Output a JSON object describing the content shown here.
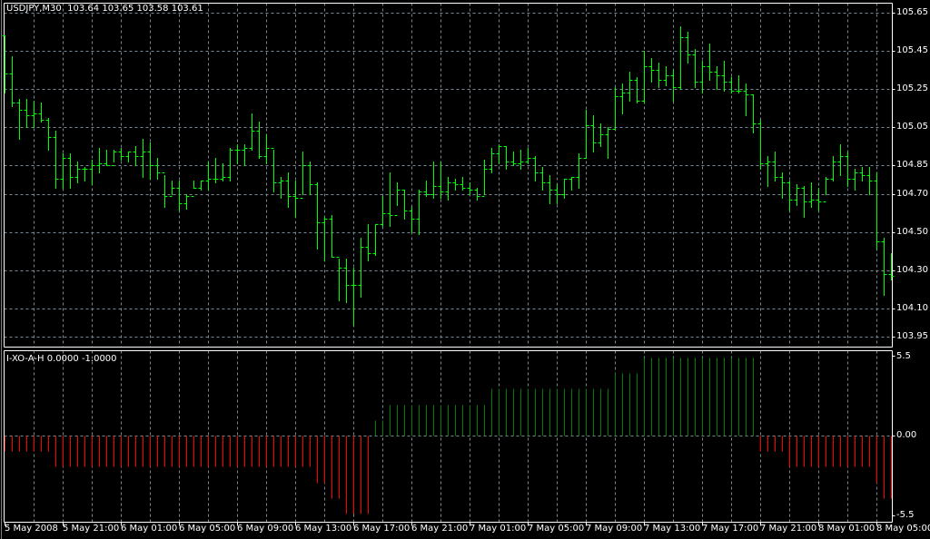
{
  "header": {
    "symbol": "USDJPY,M30",
    "open": "103.64",
    "high": "103.65",
    "low": "103.58",
    "close": "103.61"
  },
  "indicator": {
    "name": "I-XO-A-H",
    "value1": "0.0000",
    "value2": "-1.0000",
    "axis_labels": [
      "5.5",
      "0.00",
      "-5.5"
    ]
  },
  "price_axis": [
    "105.65",
    "105.45",
    "105.25",
    "105.05",
    "104.85",
    "104.70",
    "104.50",
    "104.30",
    "104.10",
    "103.95"
  ],
  "time_axis": [
    "5 May 2008",
    "5 May 21:00",
    "6 May 01:00",
    "6 May 05:00",
    "6 May 09:00",
    "6 May 13:00",
    "6 May 17:00",
    "6 May 21:00",
    "7 May 01:00",
    "7 May 05:00",
    "7 May 09:00",
    "7 May 13:00",
    "7 May 17:00",
    "7 May 21:00",
    "8 May 01:00",
    "8 May 05:00"
  ],
  "colors": {
    "background": "#000000",
    "grid": "#778899",
    "bars": "#00ff00",
    "hist_up": "#008000",
    "hist_down": "#ff0000",
    "text": "#ffffff"
  },
  "chart_data": {
    "type": "ohlc",
    "title": "USDJPY,M30",
    "ylim": [
      103.95,
      105.65
    ],
    "bar_format": [
      "high",
      "low",
      "close"
    ],
    "bars": [
      [
        105.53,
        105.23,
        105.33
      ],
      [
        105.42,
        105.16,
        105.18
      ],
      [
        105.2,
        104.99,
        105.14
      ],
      [
        105.2,
        105.05,
        105.11
      ],
      [
        105.19,
        105.05,
        105.12
      ],
      [
        105.18,
        105.08,
        105.09
      ],
      [
        105.1,
        104.93,
        105.0
      ],
      [
        105.03,
        104.73,
        104.78
      ],
      [
        104.91,
        104.73,
        104.89
      ],
      [
        104.91,
        104.73,
        104.79
      ],
      [
        104.87,
        104.76,
        104.83
      ],
      [
        104.84,
        104.77,
        104.83
      ],
      [
        104.88,
        104.75,
        104.85
      ],
      [
        104.94,
        104.81,
        104.86
      ],
      [
        104.93,
        104.85,
        104.85
      ],
      [
        104.93,
        104.87,
        104.92
      ],
      [
        104.94,
        104.88,
        104.9
      ],
      [
        104.92,
        104.87,
        104.92
      ],
      [
        104.95,
        104.85,
        104.9
      ],
      [
        104.99,
        104.79,
        104.92
      ],
      [
        104.97,
        104.78,
        104.85
      ],
      [
        104.89,
        104.78,
        104.81
      ],
      [
        104.8,
        104.63,
        104.69
      ],
      [
        104.77,
        104.7,
        104.73
      ],
      [
        104.77,
        104.61,
        104.65
      ],
      [
        104.7,
        104.62,
        104.69
      ],
      [
        104.77,
        104.73,
        104.73
      ],
      [
        104.77,
        104.72,
        104.77
      ],
      [
        104.87,
        104.72,
        104.78
      ],
      [
        104.89,
        104.76,
        104.78
      ],
      [
        104.86,
        104.77,
        104.79
      ],
      [
        104.94,
        104.77,
        104.93
      ],
      [
        104.96,
        104.86,
        104.93
      ],
      [
        104.96,
        104.85,
        104.94
      ],
      [
        105.12,
        104.93,
        105.03
      ],
      [
        105.08,
        104.89,
        104.9
      ],
      [
        105.01,
        104.86,
        104.94
      ],
      [
        104.93,
        104.71,
        104.76
      ],
      [
        104.79,
        104.68,
        104.77
      ],
      [
        104.81,
        104.63,
        104.69
      ],
      [
        104.77,
        104.58,
        104.68
      ],
      [
        104.92,
        104.7,
        104.85
      ],
      [
        104.87,
        104.7,
        104.75
      ],
      [
        104.76,
        104.41,
        104.55
      ],
      [
        104.58,
        104.35,
        104.57
      ],
      [
        104.59,
        104.37,
        104.37
      ],
      [
        104.36,
        104.14,
        104.31
      ],
      [
        104.36,
        104.13,
        104.22
      ],
      [
        104.31,
        104.01,
        104.22
      ],
      [
        104.47,
        104.16,
        104.42
      ],
      [
        104.54,
        104.35,
        104.39
      ],
      [
        104.54,
        104.38,
        104.54
      ],
      [
        104.69,
        104.53,
        104.6
      ],
      [
        104.81,
        104.53,
        104.59
      ],
      [
        104.76,
        104.64,
        104.72
      ],
      [
        104.72,
        104.57,
        104.61
      ],
      [
        104.63,
        104.5,
        104.57
      ],
      [
        104.72,
        104.49,
        104.71
      ],
      [
        104.77,
        104.69,
        104.7
      ],
      [
        104.87,
        104.68,
        104.74
      ],
      [
        104.87,
        104.68,
        104.71
      ],
      [
        104.79,
        104.67,
        104.76
      ],
      [
        104.78,
        104.72,
        104.75
      ],
      [
        104.79,
        104.72,
        104.73
      ],
      [
        104.76,
        104.7,
        104.72
      ],
      [
        104.73,
        104.67,
        104.69
      ],
      [
        104.88,
        104.7,
        104.83
      ],
      [
        104.94,
        104.81,
        104.91
      ],
      [
        104.96,
        104.86,
        104.95
      ],
      [
        104.95,
        104.83,
        104.87
      ],
      [
        104.92,
        104.85,
        104.86
      ],
      [
        104.93,
        104.83,
        104.87
      ],
      [
        104.94,
        104.86,
        104.89
      ],
      [
        104.9,
        104.77,
        104.81
      ],
      [
        104.84,
        104.72,
        104.76
      ],
      [
        104.8,
        104.65,
        104.72
      ],
      [
        104.75,
        104.65,
        104.7
      ],
      [
        104.78,
        104.68,
        104.78
      ],
      [
        104.79,
        104.72,
        104.79
      ],
      [
        104.91,
        104.73,
        104.89
      ],
      [
        105.14,
        104.89,
        105.06
      ],
      [
        105.11,
        104.92,
        104.97
      ],
      [
        105.07,
        104.95,
        105.01
      ],
      [
        105.05,
        104.89,
        105.04
      ],
      [
        105.26,
        105.04,
        105.21
      ],
      [
        105.28,
        105.12,
        105.23
      ],
      [
        105.34,
        105.19,
        105.3
      ],
      [
        105.31,
        105.18,
        105.19
      ],
      [
        105.45,
        105.18,
        105.37
      ],
      [
        105.41,
        105.29,
        105.35
      ],
      [
        105.39,
        105.26,
        105.3
      ],
      [
        105.37,
        105.27,
        105.32
      ],
      [
        105.35,
        105.19,
        105.26
      ],
      [
        105.58,
        105.25,
        105.52
      ],
      [
        105.55,
        105.39,
        105.43
      ],
      [
        105.46,
        105.26,
        105.29
      ],
      [
        105.4,
        105.23,
        105.37
      ],
      [
        105.49,
        105.3,
        105.34
      ],
      [
        105.37,
        105.25,
        105.32
      ],
      [
        105.4,
        105.24,
        105.29
      ],
      [
        105.31,
        105.23,
        105.24
      ],
      [
        105.32,
        105.23,
        105.24
      ],
      [
        105.28,
        105.11,
        105.22
      ],
      [
        105.22,
        105.02,
        105.07
      ],
      [
        105.09,
        104.83,
        104.86
      ],
      [
        104.9,
        104.74,
        104.87
      ],
      [
        104.92,
        104.77,
        104.79
      ],
      [
        104.81,
        104.68,
        104.76
      ],
      [
        104.77,
        104.61,
        104.67
      ],
      [
        104.75,
        104.64,
        104.73
      ],
      [
        104.74,
        104.58,
        104.66
      ],
      [
        104.76,
        104.63,
        104.67
      ],
      [
        104.73,
        104.61,
        104.66
      ],
      [
        104.79,
        104.7,
        104.78
      ],
      [
        104.9,
        104.77,
        104.87
      ],
      [
        104.96,
        104.8,
        104.9
      ],
      [
        104.92,
        104.74,
        104.78
      ],
      [
        104.83,
        104.72,
        104.81
      ],
      [
        104.84,
        104.77,
        104.8
      ],
      [
        104.84,
        104.7,
        104.77
      ],
      [
        104.81,
        104.41,
        104.45
      ],
      [
        104.47,
        104.17,
        104.28
      ],
      [
        104.39,
        104.25,
        104.27
      ]
    ],
    "histogram": {
      "ylim": [
        -5.5,
        5.5
      ],
      "values": [
        -1,
        -1,
        -1,
        -1,
        -1,
        -1,
        -1,
        -2,
        -2,
        -2,
        -2,
        -2,
        -2,
        -2,
        -2,
        -2,
        -2,
        -2,
        -2,
        -2,
        -2,
        -2,
        -2,
        -2,
        -2,
        -2,
        -2,
        -2,
        -2,
        -2,
        -2,
        -2,
        -2,
        -2,
        -2,
        -2,
        -2,
        -2,
        -2,
        -2,
        -2,
        -2,
        -2,
        -3,
        -3,
        -4,
        -4,
        -5,
        -5,
        -5,
        -5,
        1,
        1,
        2,
        2,
        2,
        2,
        2,
        2,
        2,
        2,
        2,
        2,
        2,
        2,
        2,
        2,
        3,
        3,
        3,
        3,
        3,
        3,
        3,
        3,
        3,
        3,
        3,
        3,
        3,
        3,
        3,
        3,
        3,
        4,
        4,
        4,
        4,
        5,
        5,
        5,
        5,
        5,
        5,
        5,
        5,
        5,
        5,
        5,
        5,
        5,
        5,
        5,
        5,
        -1,
        -1,
        -1,
        -1,
        -2,
        -2,
        -2,
        -2,
        -2,
        -2,
        -2,
        -2,
        -2,
        -2,
        -2,
        -2,
        -3,
        -4,
        -4
      ]
    }
  }
}
